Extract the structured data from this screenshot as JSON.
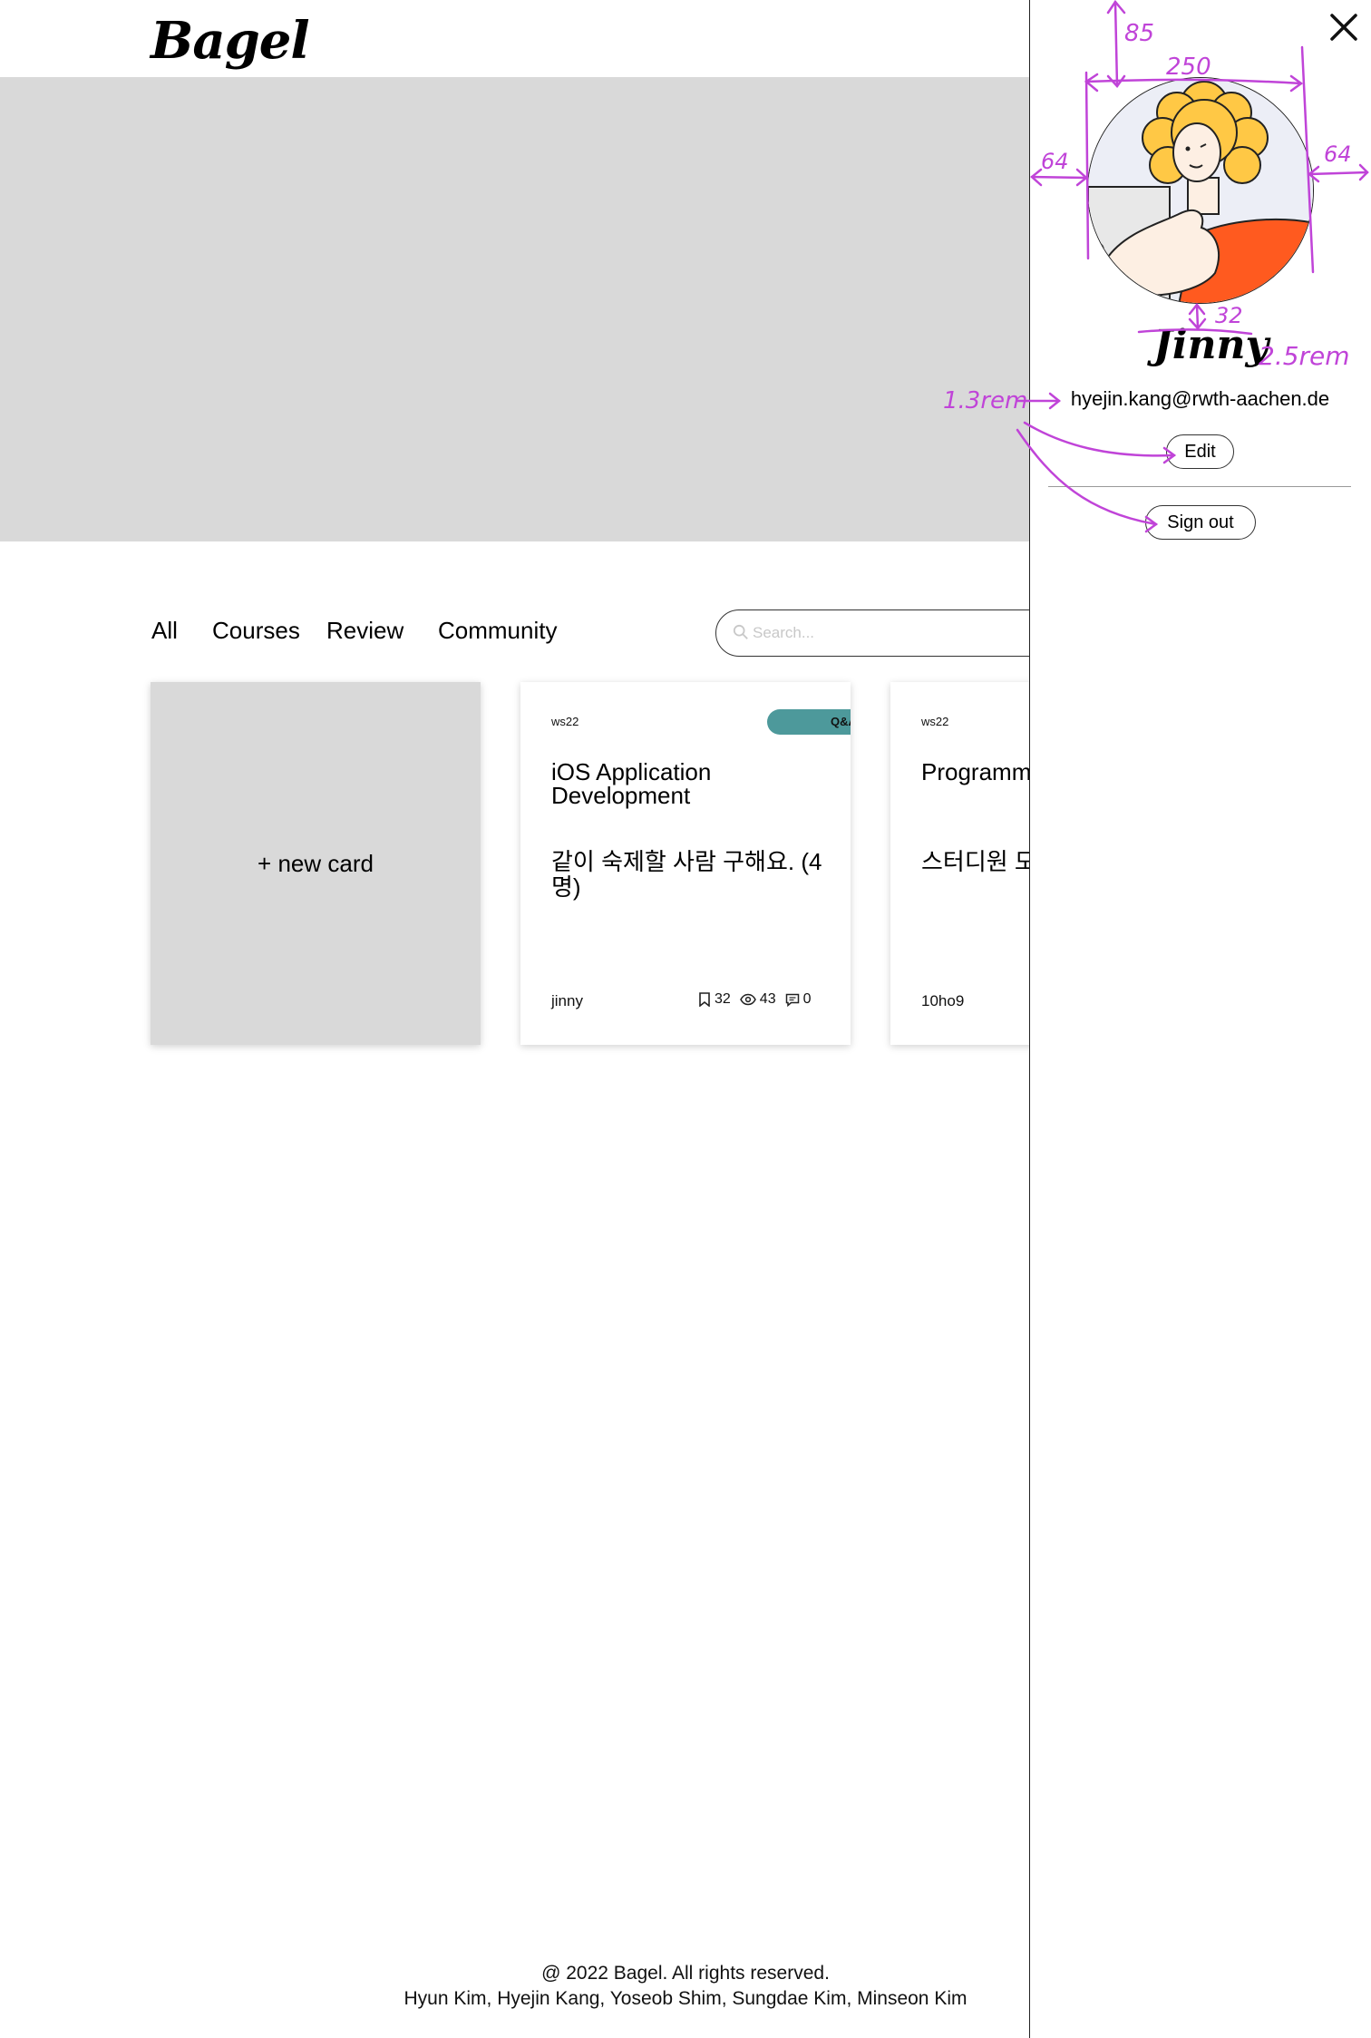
{
  "header": {
    "logo": "Bagel"
  },
  "tabs": [
    {
      "label": "All"
    },
    {
      "label": "Courses"
    },
    {
      "label": "Review"
    },
    {
      "label": "Community"
    }
  ],
  "search": {
    "placeholder": "Search..."
  },
  "new_card": {
    "label": "+ new card"
  },
  "cards": [
    {
      "semester": "ws22",
      "badge": "Q&A",
      "title": "iOS Application Development",
      "body": "같이 숙제할 사람 구해요. (4명)",
      "author": "jinny",
      "bookmarks": "32",
      "views": "43",
      "comments": "0"
    },
    {
      "semester": "ws22",
      "title": "Programming",
      "body": "스터디원 모집",
      "author": "10ho9"
    }
  ],
  "footer": {
    "copyright": "@ 2022 Bagel. All rights reserved.",
    "authors": "Hyun Kim, Hyejin Kang, Yoseob Shim, Sungdae Kim, Minseon Kim"
  },
  "profile": {
    "username": "Jinny",
    "email": "hyejin.kang@rwth-aachen.de",
    "edit_label": "Edit",
    "signout_label": "Sign out"
  },
  "annotations": {
    "top_gap": "85",
    "avatar_width": "250",
    "left_margin": "64",
    "right_margin": "64",
    "name_gap": "32",
    "name_size": "2.5rem",
    "email_size": "1.3rem"
  },
  "colors": {
    "hero": "#d9d9d9",
    "badge": "#4d999b",
    "annotation": "#c044d8"
  }
}
